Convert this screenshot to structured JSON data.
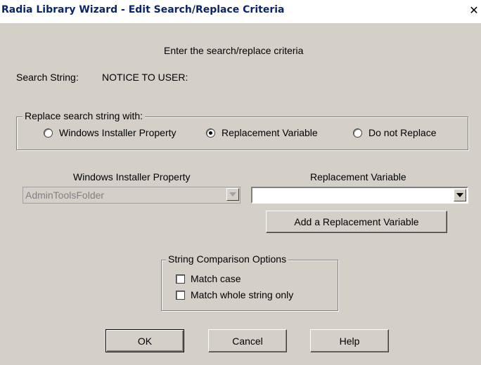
{
  "window": {
    "title": "Radia Library Wizard - Edit Search/Replace Criteria",
    "close_glyph": "✕"
  },
  "instruction": "Enter the search/replace criteria",
  "search": {
    "label": "Search String:",
    "value": "NOTICE TO USER:"
  },
  "replace_group": {
    "legend": "Replace search string with:",
    "options": [
      {
        "label": "Windows Installer Property",
        "checked": false
      },
      {
        "label": "Replacement Variable",
        "checked": true
      },
      {
        "label": "Do not Replace",
        "checked": false
      }
    ]
  },
  "wi_property": {
    "label": "Windows Installer Property",
    "value": "AdminToolsFolder",
    "enabled": false
  },
  "replacement_variable": {
    "label": "Replacement Variable",
    "value": "",
    "add_button": "Add a Replacement Variable"
  },
  "comparison": {
    "legend": "String Comparison Options",
    "options": [
      {
        "label": "Match case",
        "checked": false
      },
      {
        "label": "Match whole string only",
        "checked": false
      }
    ]
  },
  "buttons": {
    "ok": "OK",
    "cancel": "Cancel",
    "help": "Help"
  },
  "colors": {
    "dialog_bg": "#d4d0c8",
    "title_text": "#0a246a",
    "disabled_text": "#808080"
  }
}
